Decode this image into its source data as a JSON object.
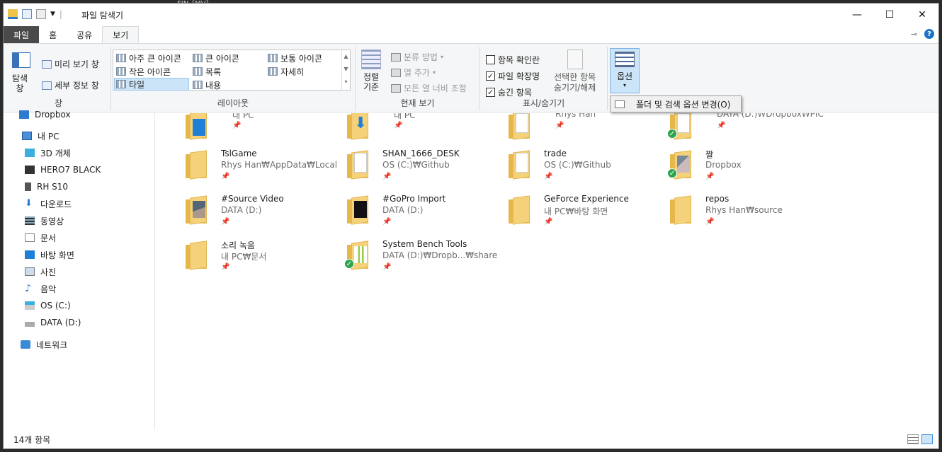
{
  "window": {
    "title": "파일 탐색기",
    "behind_text": "FIN_[MV]",
    "controls": {
      "minimize": "—",
      "maximize": "☐",
      "close": "✕"
    }
  },
  "tabs": [
    {
      "label": "파일"
    },
    {
      "label": "홈"
    },
    {
      "label": "공유"
    },
    {
      "label": "보기"
    }
  ],
  "ribbon": {
    "panes": {
      "nav_pane_label": "탐색\n창",
      "preview_label": "미리 보기 창",
      "details_label": "세부 정보 창",
      "group_label": "창"
    },
    "layout": {
      "group_label": "레이아웃",
      "items": [
        "아주 큰 아이콘",
        "큰 아이콘",
        "보통 아이콘",
        "작은 아이콘",
        "목록",
        "자세히",
        "타일",
        "내용"
      ],
      "selected": "타일"
    },
    "current_view": {
      "group_label": "현재 보기",
      "sort_label": "정렬\n기준",
      "group_by": "분류 방법",
      "add_column": "열 추가",
      "fit_columns": "모든 열 너비 조정"
    },
    "show_hide": {
      "group_label": "표시/숨기기",
      "item_checkbox": "항목 확인란",
      "file_ext": "파일 확장명",
      "hidden_items": "숨긴 항목",
      "hide_selected": "선택한 항목\n숨기기/해제"
    },
    "options": {
      "label": "옵션"
    }
  },
  "dropdown": {
    "item": "폴더 및 검색 옵션 변경(O)"
  },
  "nav": {
    "items": [
      {
        "label": "Dropbox",
        "icon": "dropbox-icon"
      },
      {
        "label": "내 PC",
        "icon": "pc-icon"
      },
      {
        "label": "3D 개체",
        "icon": "3d-objects-icon"
      },
      {
        "label": "HERO7 BLACK",
        "icon": "device-icon"
      },
      {
        "label": "RH S10",
        "icon": "phone-icon"
      },
      {
        "label": "다운로드",
        "icon": "download-icon"
      },
      {
        "label": "동영상",
        "icon": "video-icon"
      },
      {
        "label": "문서",
        "icon": "document-icon"
      },
      {
        "label": "바탕 화면",
        "icon": "desktop-icon"
      },
      {
        "label": "사진",
        "icon": "pictures-icon"
      },
      {
        "label": "음악",
        "icon": "music-icon"
      },
      {
        "label": "OS (C:)",
        "icon": "drive-c-icon"
      },
      {
        "label": "DATA (D:)",
        "icon": "drive-d-icon"
      },
      {
        "label": "네트워크",
        "icon": "network-icon"
      }
    ]
  },
  "tiles": [
    {
      "name": "",
      "path": "내 PC"
    },
    {
      "name": "",
      "path": "내 PC"
    },
    {
      "name": "",
      "path": "Rhys Han"
    },
    {
      "name": "",
      "path": "DATA (D:)₩Dropbox₩PIC"
    },
    {
      "name": "TslGame",
      "path": "Rhys Han₩AppData₩Local"
    },
    {
      "name": "SHAN_1666_DESK",
      "path": "OS (C:)₩Github"
    },
    {
      "name": "trade",
      "path": "OS (C:)₩Github"
    },
    {
      "name": "짤",
      "path": "Dropbox"
    },
    {
      "name": "#Source Video",
      "path": "DATA (D:)"
    },
    {
      "name": "#GoPro Import",
      "path": "DATA (D:)"
    },
    {
      "name": "GeForce Experience",
      "path": "내 PC₩바탕 화면"
    },
    {
      "name": "repos",
      "path": "Rhys Han₩source"
    },
    {
      "name": "소리 녹음",
      "path": "내 PC₩문서"
    },
    {
      "name": "System Bench Tools",
      "path": "DATA (D:)₩Dropb...₩share"
    }
  ],
  "status": {
    "count": "14개 항목"
  },
  "colors": {
    "accent": "#1a73c9",
    "folder": "#f5d27a",
    "selected": "#cce4f7",
    "sync_ok": "#2da44e"
  }
}
